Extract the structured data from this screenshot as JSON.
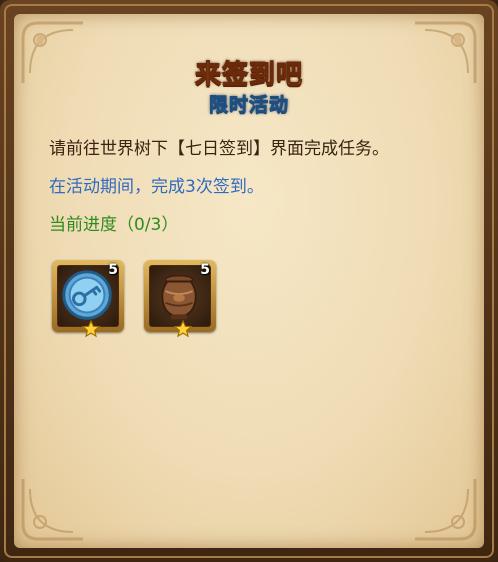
{
  "panel": {
    "title": "来签到吧",
    "subtitle": "限时活动",
    "description": "请前往世界树下【七日签到】界面完成任务。",
    "requirement": "在活动期间，完成3次签到。",
    "progress": "当前进度（0/3）"
  },
  "rewards": [
    {
      "icon": "key-token-icon",
      "count": "5",
      "stars": 1
    },
    {
      "icon": "bronze-urn-icon",
      "count": "5",
      "stars": 1
    }
  ],
  "colors": {
    "title": "#f2a23a",
    "subtitle": "#d8f1ff",
    "description": "#3b2310",
    "requirement": "#2f6bc0",
    "progress": "#2e8b1e"
  }
}
